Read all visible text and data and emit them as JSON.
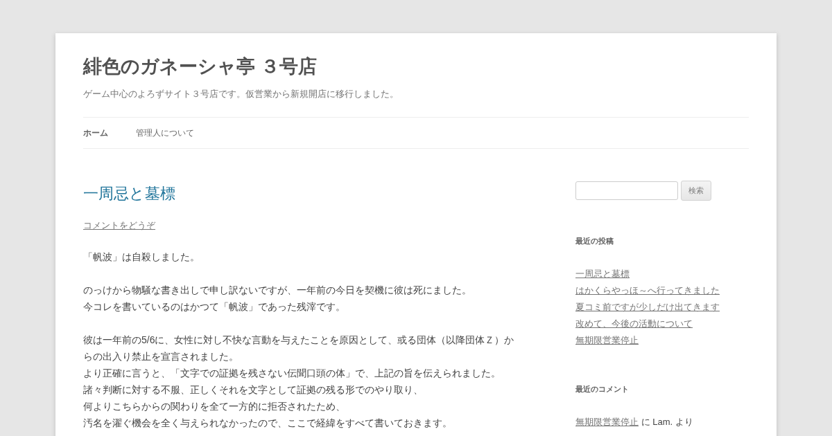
{
  "site": {
    "title": "緋色のガネーシャ亭 ３号店",
    "tagline": "ゲーム中心のよろずサイト３号店です。仮営業から新規開店に移行しました。"
  },
  "nav": [
    {
      "label": "ホーム",
      "selected": true
    },
    {
      "label": "管理人について",
      "selected": false
    }
  ],
  "post": {
    "title": "一周忌と墓標",
    "comments_link": "コメントをどうぞ",
    "paragraphs": [
      [
        "「帆波」は自殺しました。"
      ],
      [
        "のっけから物騒な書き出しで申し訳ないですが、一年前の今日を契機に彼は死にました。",
        "今コレを書いているのはかつて「帆波」であった残滓です。"
      ],
      [
        "彼は一年前の5/6に、女性に対し不快な言動を与えたことを原因として、或る団体（以降団体Ｚ）か",
        "らの出入り禁止を宣言されました。",
        "より正確に言うと、「文字での証拠を残さない伝聞口頭の体」で、上記の旨を伝えられました。",
        "諸々判断に対する不服、正しくそれを文字として証拠の残る形でのやり取り、",
        "何よりこちらからの関わりを全て一方的に拒否されたため、",
        "汚名を濯ぐ機会を全く与えられなかったので、ここで経緯をすべて書いておきます。"
      ]
    ]
  },
  "sidebar": {
    "search_button": "検索",
    "recent_posts": {
      "title": "最近の投稿",
      "items": [
        "一周忌と墓標",
        "はかくらやっほ～へ行ってきました",
        "夏コミ前ですが少しだけ出てきます",
        "改めて、今後の活動について",
        "無期限営業停止"
      ]
    },
    "recent_comments": {
      "title": "最近のコメント",
      "items": [
        {
          "post": "無期限営業停止",
          "text": "に Lam. より"
        }
      ]
    }
  }
}
